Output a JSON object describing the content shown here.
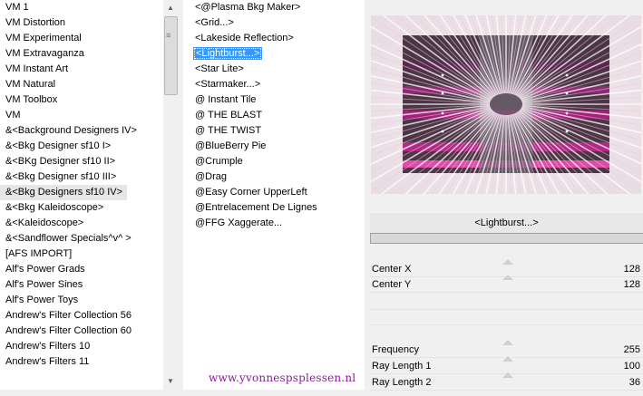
{
  "categories": [
    "VM 1",
    "VM Distortion",
    "VM Experimental",
    "VM Extravaganza",
    "VM Instant Art",
    "VM Natural",
    "VM Toolbox",
    "VM",
    "&<Background Designers IV>",
    "&<Bkg Designer sf10 I>",
    "&<BKg Designer sf10 II>",
    "&<Bkg Designer sf10 III>",
    "&<Bkg Designers sf10 IV>",
    "&<Bkg Kaleidoscope>",
    "&<Kaleidoscope>",
    "&<Sandflower Specials^v^ >",
    "[AFS IMPORT]",
    "Alf's Power Grads",
    "Alf's Power Sines",
    "Alf's Power Toys",
    "Andrew's Filter Collection 56",
    "Andrew's Filter Collection 60",
    "Andrew's Filters 10",
    "Andrew's Filters 11"
  ],
  "selected_category": "&<Bkg Designers sf10 IV>",
  "filters": [
    "<@Plasma Bkg Maker>",
    "<Grid...>",
    "<Lakeside Reflection>",
    "<Lightburst...>",
    "<Star Lite>",
    "<Starmaker...>",
    "@ Instant Tile",
    "@ THE BLAST",
    "@ THE TWIST",
    "@BlueBerry Pie",
    "@Crumple",
    "@Drag",
    "@Easy Corner UpperLeft",
    "@Entrelacement De Lignes",
    "@FFG Xaggerate..."
  ],
  "selected_filter": "<Lightburst...>",
  "watermark": "www.yvonnespsplessen.nl",
  "filter_title": "<Lightburst...>",
  "params": [
    {
      "label": "Center X",
      "value": "128"
    },
    {
      "label": "Center Y",
      "value": "128"
    },
    {
      "label": "Frequency",
      "value": "255"
    },
    {
      "label": "Ray Length 1",
      "value": "100"
    },
    {
      "label": "Ray Length 2",
      "value": "36"
    }
  ],
  "colors": {
    "accent": "#3399ff",
    "watermark": "#8c1b9a",
    "preview_magenta": "#c0307a"
  }
}
